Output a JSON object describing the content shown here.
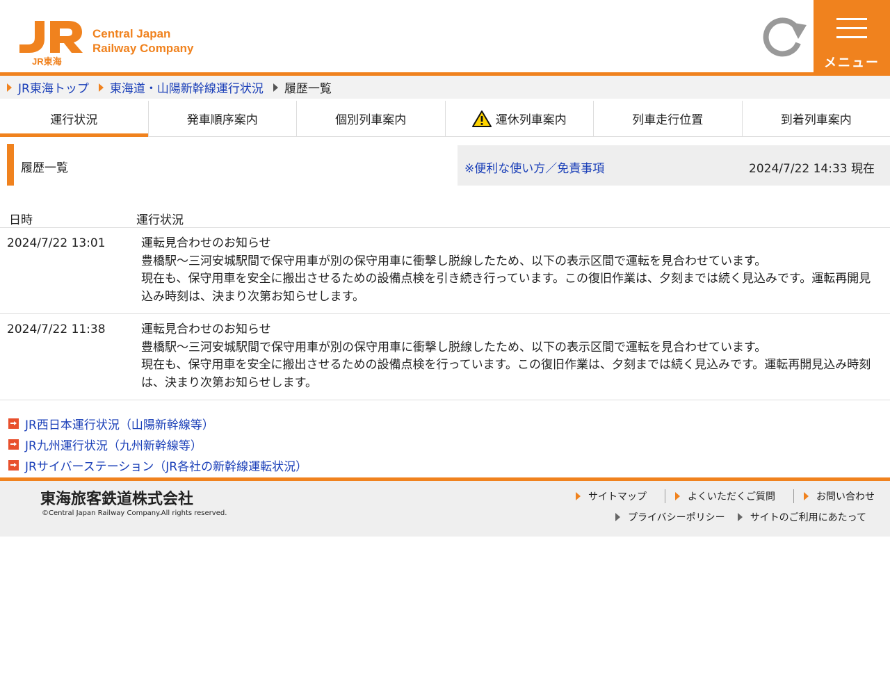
{
  "header": {
    "logo_line1": "Central Japan",
    "logo_line2": "Railway Company",
    "logo_sub": "JR東海",
    "menu_label": "メニュー"
  },
  "breadcrumb": [
    {
      "label": "JR東海トップ"
    },
    {
      "label": "東海道・山陽新幹線運行状況"
    },
    {
      "label": "履歴一覧"
    }
  ],
  "tabs": [
    {
      "label": "運行状況",
      "active": true
    },
    {
      "label": "発車順序案内"
    },
    {
      "label": "個別列車案内"
    },
    {
      "label": "運休列車案内",
      "icon": "warning-icon"
    },
    {
      "label": "列車走行位置"
    },
    {
      "label": "到着列車案内"
    }
  ],
  "section": {
    "title": "履歴一覧",
    "help_link": "※便利な使い方／免責事項",
    "timestamp": "2024/7/22 14:33 現在"
  },
  "history": {
    "col_date": "日時",
    "col_status": "運行状況",
    "rows": [
      {
        "date": "2024/7/22 13:01",
        "title": "運転見合わせのお知らせ",
        "line1": "豊橋駅～三河安城駅間で保守用車が別の保守用車に衝撃し脱線したため、以下の表示区間で運転を見合わせています。",
        "line2": "現在も、保守用車を安全に搬出させるための設備点検を引き続き行っています。この復旧作業は、夕刻までは続く見込みです。運転再開見込み時刻は、決まり次第お知らせします。"
      },
      {
        "date": "2024/7/22 11:38",
        "title": "運転見合わせのお知らせ",
        "line1": "豊橋駅～三河安城駅間で保守用車が別の保守用車に衝撃し脱線したため、以下の表示区間で運転を見合わせています。",
        "line2": "現在も、保守用車を安全に搬出させるための設備点検を行っています。この復旧作業は、夕刻までは続く見込みです。運転再開見込み時刻は、決まり次第お知らせします。"
      }
    ]
  },
  "links": [
    {
      "label": "JR西日本運行状況（山陽新幹線等）"
    },
    {
      "label": "JR九州運行状況（九州新幹線等）"
    },
    {
      "label": "JRサイバーステーション（JR各社の新幹線運転状況）"
    }
  ],
  "footer": {
    "company": "東海旅客鉄道株式会社",
    "copyright": "©Central Japan Railway Company.All rights reserved.",
    "links_row1": [
      {
        "label": "サイトマップ"
      },
      {
        "label": "よくいただくご質問"
      },
      {
        "label": "お問い合わせ"
      }
    ],
    "links_row2": [
      {
        "label": "プライバシーポリシー"
      },
      {
        "label": "サイトのご利用にあたって"
      }
    ]
  },
  "colors": {
    "accent": "#f0821e",
    "link": "#1a3fb8",
    "link_arrow": "#e8502d"
  }
}
